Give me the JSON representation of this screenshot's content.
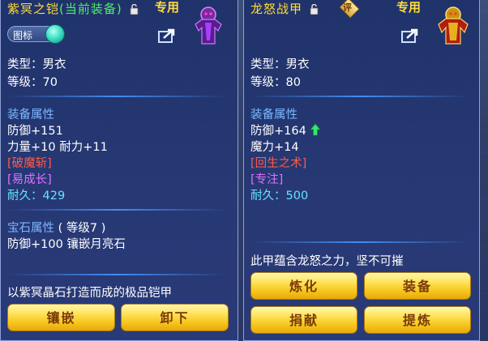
{
  "left_panel": {
    "title_name": "紫冥之铠",
    "title_status": "(当前装备)",
    "exclusive": "专用",
    "tag_toggle_label": "图标",
    "type": "类型：男衣",
    "level": "等级：70",
    "attr_header": "装备属性",
    "defense": "防御+151",
    "str_end": "力量+10 耐力+11",
    "skill": "[破魔斩]",
    "special": "[易成长]",
    "durability": "耐久：429",
    "gem_header": "宝石属性",
    "gem_level": "( 等级7 )",
    "gem_effect": "防御+100 镶嵌月亮石",
    "description": "以紫冥晶石打造而成的极品铠甲",
    "buttons": [
      "镶嵌",
      "卸下"
    ]
  },
  "right_panel": {
    "title_name": "龙怒战甲",
    "rating_badge": "评",
    "exclusive": "专用",
    "type": "类型：男衣",
    "level": "等级：80",
    "attr_header": "装备属性",
    "defense": "防御+164",
    "magic": "魔力+14",
    "skill": "[回生之术]",
    "special": "[专注]",
    "durability": "耐久：500",
    "description": "此甲蕴含龙怒之力，坚不可摧",
    "buttons": [
      "炼化",
      "装备",
      "捐献",
      "提炼"
    ]
  },
  "colors": {
    "title_gold": "#ffdc3a",
    "current_green": "#4cf06a",
    "header_blue": "#7ab8ff",
    "skill_red": "#ff5a4a",
    "special_purple": "#e070ff",
    "durability_cyan": "#64e2ff",
    "button_gold": "#f6c51c"
  },
  "icons": {
    "lock": "lock-icon",
    "share": "share-icon",
    "upgrade_arrow": "green-up-arrow-icon"
  }
}
